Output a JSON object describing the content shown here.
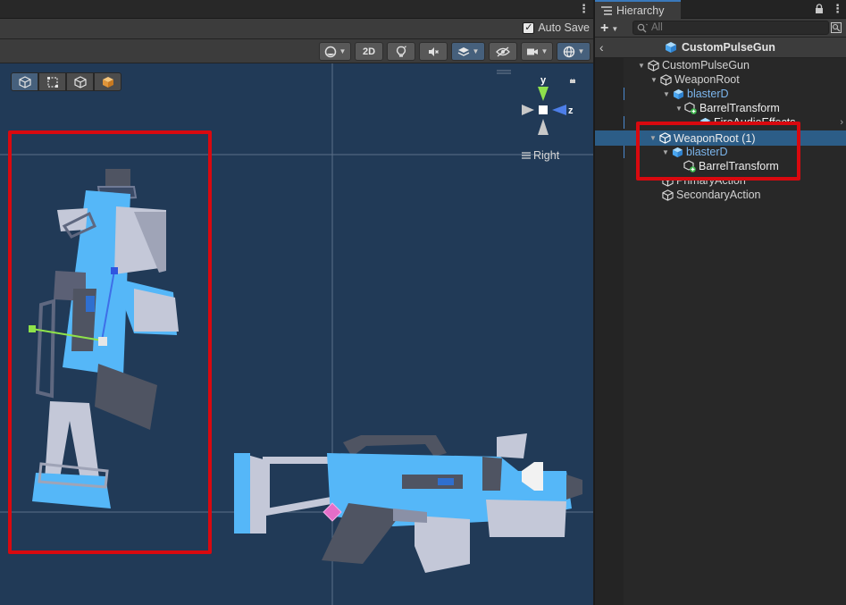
{
  "scene": {
    "autosave": {
      "label": "Auto Save",
      "checked": true
    },
    "toolbar": {
      "mode_2d": "2D"
    },
    "orientation": {
      "view_label": "Right",
      "y_axis": "y",
      "z_axis": "z"
    }
  },
  "hierarchy": {
    "tab_title": "Hierarchy",
    "search_placeholder": "All",
    "prefab_title": "CustomPulseGun",
    "rows": [
      {
        "label": "CustomPulseGun",
        "icon": "gameobject-icon",
        "depth": 0,
        "foldout": "expanded"
      },
      {
        "label": "WeaponRoot",
        "icon": "gameobject-icon",
        "depth": 1,
        "foldout": "expanded"
      },
      {
        "label": "blasterD",
        "icon": "prefab-icon",
        "depth": 2,
        "foldout": "expanded",
        "prefab": true
      },
      {
        "label": "BarrelTransform",
        "icon": "gameobject-plus-icon",
        "depth": 3,
        "foldout": "expanded"
      },
      {
        "label": "FireAudioEffects",
        "icon": "prefab-icon",
        "depth": 4,
        "partially_hidden": true
      },
      {
        "label": "WeaponRoot (1)",
        "icon": "gameobject-icon",
        "depth": 1,
        "foldout": "expanded",
        "selected": true
      },
      {
        "label": "blasterD",
        "icon": "prefab-icon",
        "depth": 2,
        "foldout": "expanded",
        "prefab": true
      },
      {
        "label": "BarrelTransform",
        "icon": "gameobject-plus-icon",
        "depth": 3
      },
      {
        "label": "PrimaryAction",
        "icon": "gameobject-icon",
        "depth": 1,
        "partially_hidden": true
      },
      {
        "label": "SecondaryAction",
        "icon": "gameobject-icon",
        "depth": 1
      }
    ]
  },
  "colors": {
    "viewport_bg": "#213a57",
    "selection": "#2c5d87",
    "highlight_box": "#d9090f",
    "weapon_blue": "#55b7f8",
    "weapon_grey": "#c4c8d8",
    "prefab_text": "#7cb6ee"
  }
}
